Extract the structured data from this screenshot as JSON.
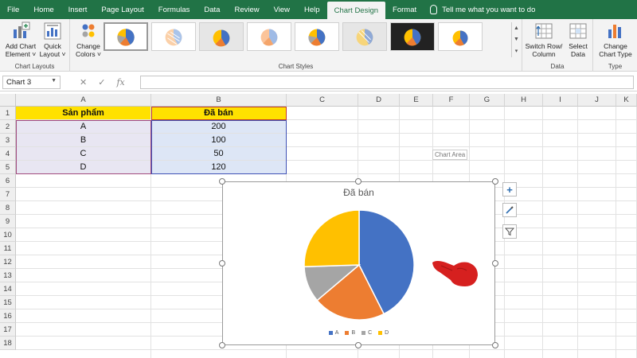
{
  "tabs": [
    {
      "label": "File"
    },
    {
      "label": "Home"
    },
    {
      "label": "Insert"
    },
    {
      "label": "Page Layout"
    },
    {
      "label": "Formulas"
    },
    {
      "label": "Data"
    },
    {
      "label": "Review"
    },
    {
      "label": "View"
    },
    {
      "label": "Help"
    },
    {
      "label": "Chart Design",
      "active": true
    },
    {
      "label": "Format"
    }
  ],
  "tell_me": "Tell me what you want to do",
  "ribbon": {
    "add_chart_element": "Add Chart\nElement ˅",
    "quick_layout": "Quick\nLayout ˅",
    "chart_layouts_group": "Chart Layouts",
    "change_colors": "Change\nColors ˅",
    "chart_styles_group": "Chart Styles",
    "switch_row_column": "Switch Row/\nColumn",
    "select_data": "Select\nData",
    "data_group": "Data",
    "change_chart_type": "Change\nChart Type",
    "type_group": "Type"
  },
  "formula_bar": {
    "name_box": "Chart 3",
    "fx": "fx",
    "value": ""
  },
  "columns": [
    "A",
    "B",
    "C",
    "D",
    "E",
    "F",
    "G",
    "H",
    "I",
    "J",
    "K"
  ],
  "rows": [
    "1",
    "2",
    "3",
    "4",
    "5",
    "6",
    "7",
    "8",
    "9",
    "10",
    "11",
    "12",
    "13",
    "14",
    "15",
    "16",
    "17",
    "18"
  ],
  "table": {
    "headers": [
      "Sản phẩm",
      "Đã bán"
    ],
    "rows": [
      {
        "product": "A",
        "sold": "200"
      },
      {
        "product": "B",
        "sold": "100"
      },
      {
        "product": "C",
        "sold": "50"
      },
      {
        "product": "D",
        "sold": "120"
      }
    ]
  },
  "tooltip": "Chart Area",
  "chart_data": {
    "type": "pie",
    "title": "Đã bán",
    "categories": [
      "A",
      "B",
      "C",
      "D"
    ],
    "values": [
      200,
      100,
      50,
      120
    ],
    "colors": [
      "#4472C4",
      "#ED7D31",
      "#A5A5A5",
      "#FFC000"
    ],
    "legend_position": "bottom"
  },
  "side_buttons": {
    "plus": "+",
    "filter": "▼"
  },
  "colors": {
    "excel_green": "#217346",
    "header_fill": "#FFE100"
  }
}
